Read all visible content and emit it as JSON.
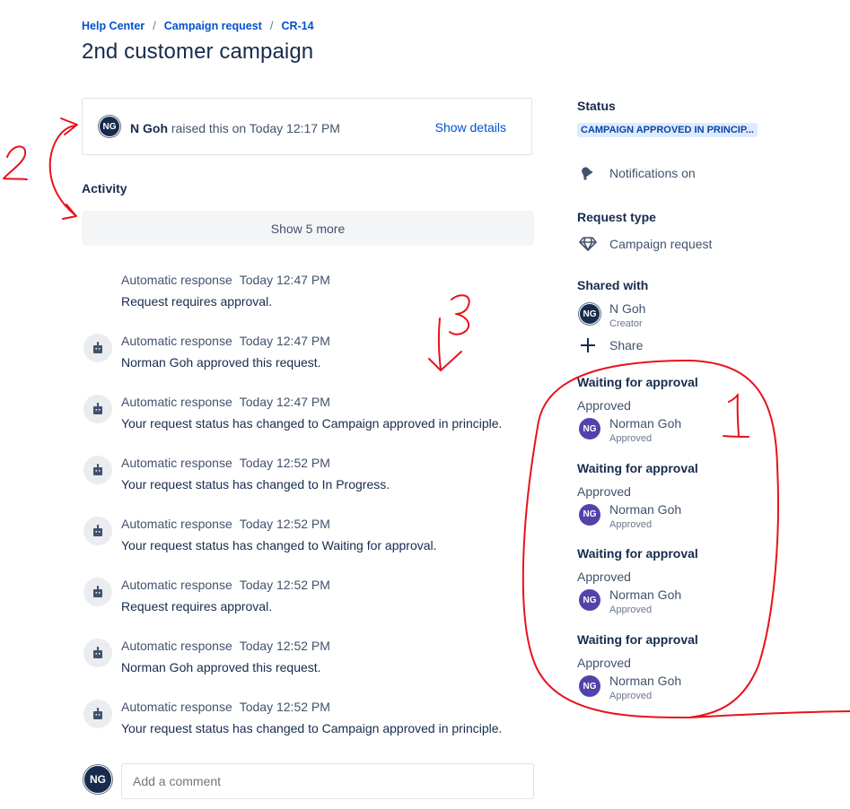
{
  "breadcrumb": [
    "Help Center",
    "Campaign request",
    "CR-14"
  ],
  "page_title": "2nd customer campaign",
  "raised": {
    "avatar_initials": "NG",
    "author": "N Goh",
    "text": "raised this on Today 12:17 PM",
    "show_details": "Show details"
  },
  "activity": {
    "heading": "Activity",
    "show_more": "Show 5 more",
    "items": [
      {
        "author": "Automatic response",
        "when": "Today 12:47 PM",
        "text": "Request requires approval.",
        "icon": "none"
      },
      {
        "author": "Automatic response",
        "when": "Today 12:47 PM",
        "text": "Norman Goh approved this request.",
        "icon": "bot-icon"
      },
      {
        "author": "Automatic response",
        "when": "Today 12:47 PM",
        "text": "Your request status has changed to Campaign approved in principle.",
        "icon": "bot-icon"
      },
      {
        "author": "Automatic response",
        "when": "Today 12:52 PM",
        "text": "Your request status has changed to In Progress.",
        "icon": "bot-icon"
      },
      {
        "author": "Automatic response",
        "when": "Today 12:52 PM",
        "text": "Your request status has changed to Waiting for approval.",
        "icon": "bot-icon"
      },
      {
        "author": "Automatic response",
        "when": "Today 12:52 PM",
        "text": "Request requires approval.",
        "icon": "bot-icon"
      },
      {
        "author": "Automatic response",
        "when": "Today 12:52 PM",
        "text": "Norman Goh approved this request.",
        "icon": "bot-icon"
      },
      {
        "author": "Automatic response",
        "when": "Today 12:52 PM",
        "text": "Your request status has changed to Campaign approved in principle.",
        "icon": "bot-icon"
      }
    ]
  },
  "comment": {
    "avatar_initials": "NG",
    "placeholder": "Add a comment"
  },
  "sidebar": {
    "status_heading": "Status",
    "status_value": "CAMPAIGN APPROVED IN PRINCIP...",
    "notifications": "Notifications on",
    "request_type_heading": "Request type",
    "request_type": "Campaign request",
    "shared_heading": "Shared with",
    "shared_person": {
      "initials": "NG",
      "name": "N Goh",
      "role": "Creator"
    },
    "share_label": "Share",
    "approvals": [
      {
        "heading": "Waiting for approval",
        "status": "Approved",
        "initials": "NG",
        "name": "Norman Goh",
        "sub": "Approved"
      },
      {
        "heading": "Waiting for approval",
        "status": "Approved",
        "initials": "NG",
        "name": "Norman Goh",
        "sub": "Approved"
      },
      {
        "heading": "Waiting for approval",
        "status": "Approved",
        "initials": "NG",
        "name": "Norman Goh",
        "sub": "Approved"
      },
      {
        "heading": "Waiting for approval",
        "status": "Approved",
        "initials": "NG",
        "name": "Norman Goh",
        "sub": "Approved"
      }
    ]
  },
  "colors": {
    "link": "#0052cc",
    "text": "#172b4d",
    "lozenge_bg": "#deebff",
    "lozenge_text": "#0747a6",
    "annotation": "#e8121c"
  },
  "annotations": [
    "2",
    "3",
    "1"
  ]
}
